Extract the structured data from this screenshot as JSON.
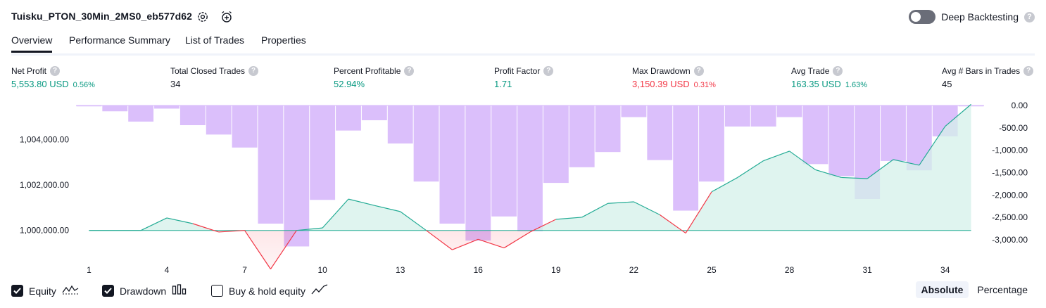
{
  "header": {
    "title": "Tuisku_PTON_30Min_2MS0_eb577d62",
    "settings_icon": "gear-icon",
    "add_alert_icon": "alarm-clock-plus-icon",
    "deep_backtesting_label": "Deep Backtesting",
    "deep_backtesting_enabled": false,
    "help_glyph": "?"
  },
  "tabs": [
    {
      "label": "Overview",
      "active": true
    },
    {
      "label": "Performance Summary",
      "active": false
    },
    {
      "label": "List of Trades",
      "active": false
    },
    {
      "label": "Properties",
      "active": false
    }
  ],
  "metrics": [
    {
      "label": "Net Profit",
      "value": "5,553.80 USD",
      "sub": "0.56%",
      "color": "green"
    },
    {
      "label": "Total Closed Trades",
      "value": "34",
      "sub": "",
      "color": "dark"
    },
    {
      "label": "Percent Profitable",
      "value": "52.94%",
      "sub": "",
      "color": "green"
    },
    {
      "label": "Profit Factor",
      "value": "1.71",
      "sub": "",
      "color": "green"
    },
    {
      "label": "Max Drawdown",
      "value": "3,150.39 USD",
      "sub": "0.31%",
      "color": "red"
    },
    {
      "label": "Avg Trade",
      "value": "163.35 USD",
      "sub": "1.63%",
      "color": "green"
    },
    {
      "label": "Avg # Bars in Trades",
      "value": "45",
      "sub": "",
      "color": "dark"
    }
  ],
  "colors": {
    "positive": "#089981",
    "negative": "#f23645",
    "drawdown_bar": "#d7b8fb",
    "equity_fill": "#d4f0ea",
    "equity_line": "#22ab94"
  },
  "chart_data": {
    "type": "area",
    "x_ticks": [
      "1",
      "4",
      "7",
      "10",
      "13",
      "16",
      "19",
      "22",
      "25",
      "28",
      "31",
      "34"
    ],
    "left_axis": {
      "ticks": [
        "1,000,000.00",
        "1,002,000.00",
        "1,004,000.00"
      ],
      "ylim": [
        999000,
        1005500
      ]
    },
    "right_axis": {
      "ticks": [
        "0.00",
        "-500.00",
        "-1,000.00",
        "-1,500.00",
        "-2,000.00",
        "-2,500.00",
        "-3,000.00"
      ],
      "ylim": [
        -3300,
        0
      ]
    },
    "series": [
      {
        "name": "Equity",
        "x": [
          1,
          2,
          3,
          4,
          5,
          6,
          7,
          8,
          9,
          10,
          11,
          12,
          13,
          14,
          15,
          16,
          17,
          18,
          19,
          20,
          21,
          22,
          23,
          24,
          25,
          26,
          27,
          28,
          29,
          30,
          31,
          32,
          33,
          34,
          35
        ],
        "values": [
          1000000,
          1000000,
          1000000,
          1000550,
          1000300,
          999930,
          1000000,
          998300,
          1000000,
          1000110,
          1001380,
          1001100,
          1000830,
          1000000,
          999150,
          999610,
          999230,
          999930,
          1000490,
          1000580,
          1001190,
          1001260,
          1000690,
          999880,
          1001700,
          1002330,
          1003070,
          1003490,
          1002670,
          1002330,
          1002280,
          1003120,
          1002870,
          1004580,
          1005550
        ]
      },
      {
        "name": "Drawdown",
        "x": [
          1,
          2,
          3,
          4,
          5,
          6,
          7,
          8,
          9,
          10,
          11,
          12,
          13,
          14,
          15,
          16,
          17,
          18,
          19,
          20,
          21,
          22,
          23,
          24,
          25,
          26,
          27,
          28,
          29,
          30,
          31,
          32,
          33,
          34,
          35
        ],
        "values": [
          -20,
          -130,
          -360,
          -70,
          -440,
          -650,
          -940,
          -2640,
          -3150,
          -2110,
          -560,
          -330,
          -850,
          -1700,
          -2640,
          -3020,
          -2480,
          -2810,
          -1730,
          -1380,
          -1040,
          -260,
          -1220,
          -2350,
          -1700,
          -470,
          -470,
          -260,
          -1310,
          -1580,
          -2090,
          -1240,
          -1450,
          -690,
          -20
        ]
      }
    ]
  },
  "legend": {
    "equity": {
      "label": "Equity",
      "checked": true,
      "icon": "equity-wave-icon"
    },
    "drawdown": {
      "label": "Drawdown",
      "checked": true,
      "icon": "drawdown-bars-icon"
    },
    "buyhold": {
      "label": "Buy & hold equity",
      "checked": false,
      "icon": "buy-hold-line-icon"
    }
  },
  "modes": {
    "absolute": "Absolute",
    "percentage": "Percentage",
    "active": "absolute"
  }
}
